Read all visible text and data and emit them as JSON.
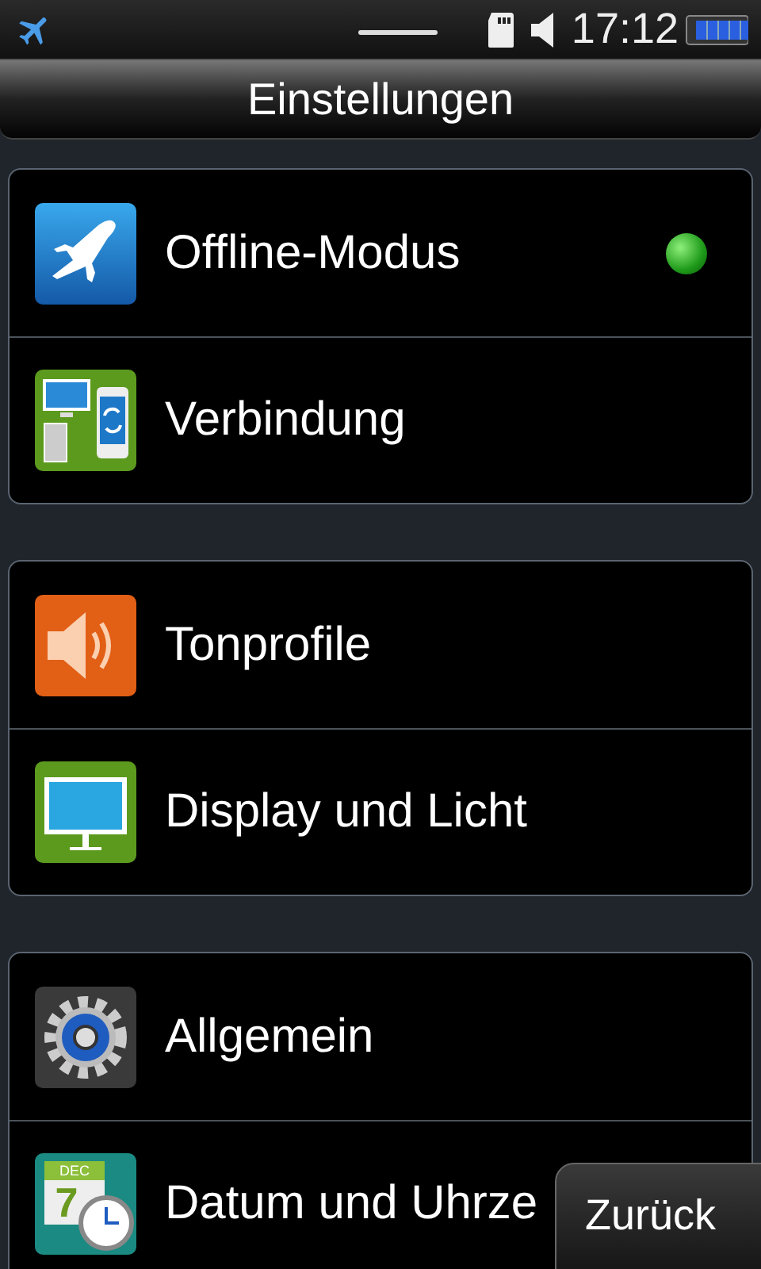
{
  "status_bar": {
    "time": "17:12"
  },
  "title": "Einstellungen",
  "groups": [
    {
      "items": [
        {
          "label": "Offline-Modus",
          "on": true
        },
        {
          "label": "Verbindung"
        }
      ]
    },
    {
      "items": [
        {
          "label": "Tonprofile"
        },
        {
          "label": "Display und Licht"
        }
      ]
    },
    {
      "items": [
        {
          "label": "Allgemein"
        },
        {
          "label": "Datum und Uhrze",
          "icon_month": "DEC",
          "icon_day": "7"
        }
      ]
    }
  ],
  "back_button": "Zurück"
}
